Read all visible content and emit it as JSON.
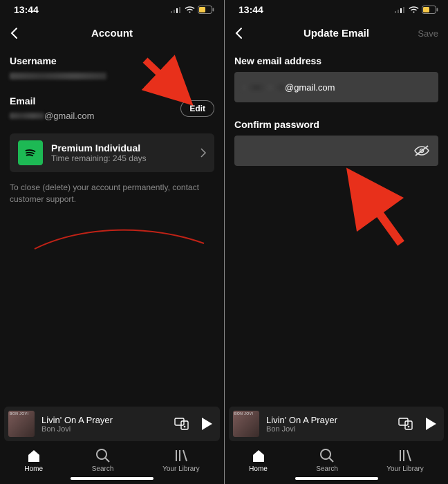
{
  "status": {
    "time": "13:44"
  },
  "left": {
    "title": "Account",
    "username_label": "Username",
    "email_label": "Email",
    "email_suffix": "@gmail.com",
    "edit": "Edit",
    "plan_name": "Premium Individual",
    "plan_sub": "Time remaining: 245 days",
    "close_note": "To close (delete) your account permanently, contact customer support."
  },
  "right": {
    "title": "Update Email",
    "save": "Save",
    "new_email_label": "New email address",
    "email_suffix": "gmail.com",
    "confirm_label": "Confirm password"
  },
  "nowplaying": {
    "track": "Livin' On A Prayer",
    "artist": "Bon Jovi"
  },
  "tabs": {
    "home": "Home",
    "search": "Search",
    "library": "Your Library"
  }
}
